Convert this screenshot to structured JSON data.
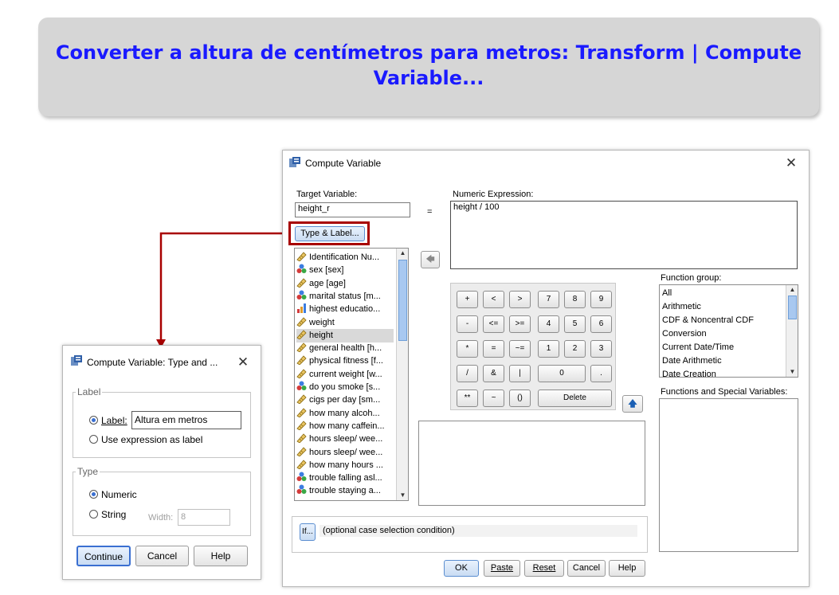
{
  "banner": {
    "title": "Converter a altura de centímetros para metros: Transform | Compute Variable..."
  },
  "compute_dialog": {
    "title": "Compute Variable",
    "target_label": "Target Variable:",
    "target_value": "height_r",
    "equals": "=",
    "expression_label": "Numeric Expression:",
    "expression_value": "height / 100",
    "type_label_button": "Type & Label...",
    "variables": [
      {
        "name": "Identification Nu...",
        "icon": "scale-icon"
      },
      {
        "name": "sex [sex]",
        "icon": "nominal-icon"
      },
      {
        "name": "age [age]",
        "icon": "scale-icon"
      },
      {
        "name": "marital status [m...",
        "icon": "nominal-icon"
      },
      {
        "name": "highest educatio...",
        "icon": "ordinal-icon"
      },
      {
        "name": "weight",
        "icon": "scale-icon"
      },
      {
        "name": "height",
        "icon": "scale-icon",
        "selected": true
      },
      {
        "name": "general health [h...",
        "icon": "scale-icon"
      },
      {
        "name": "physical fitness [f...",
        "icon": "scale-icon"
      },
      {
        "name": "current weight [w...",
        "icon": "scale-icon"
      },
      {
        "name": "do you smoke [s...",
        "icon": "nominal-icon"
      },
      {
        "name": "cigs per day  [sm...",
        "icon": "scale-icon"
      },
      {
        "name": "how  many alcoh...",
        "icon": "scale-icon"
      },
      {
        "name": "how many caffein...",
        "icon": "scale-icon"
      },
      {
        "name": "hours sleep/ wee...",
        "icon": "scale-icon"
      },
      {
        "name": "hours sleep/ wee...",
        "icon": "scale-icon"
      },
      {
        "name": "how many hours ...",
        "icon": "scale-icon"
      },
      {
        "name": "trouble falling asl...",
        "icon": "nominal-icon"
      },
      {
        "name": "trouble staying a...",
        "icon": "nominal-icon"
      }
    ],
    "keypad": {
      "row1": [
        "+",
        "<",
        ">",
        "7",
        "8",
        "9"
      ],
      "row2": [
        "-",
        "<=",
        ">=",
        "4",
        "5",
        "6"
      ],
      "row3": [
        "*",
        "=",
        "~=",
        "1",
        "2",
        "3"
      ],
      "row4": [
        "/",
        "&",
        "|",
        "0",
        "."
      ],
      "row5": [
        "**",
        "~",
        "()",
        "Delete"
      ]
    },
    "function_group_label": "Function group:",
    "function_groups": [
      "All",
      "Arithmetic",
      "CDF & Noncentral CDF",
      "Conversion",
      "Current Date/Time",
      "Date Arithmetic",
      "Date Creation"
    ],
    "functions_label": "Functions and Special Variables:",
    "if_button": "If...",
    "if_text": "(optional case selection condition)",
    "buttons": {
      "ok": "OK",
      "paste": "Paste",
      "reset": "Reset",
      "cancel": "Cancel",
      "help": "Help"
    }
  },
  "type_dialog": {
    "title": "Compute Variable: Type and ...",
    "label_group": "Label",
    "label_radio": "Label:",
    "label_value": "Altura em metros",
    "use_expression": "Use expression as label",
    "type_group": "Type",
    "numeric": "Numeric",
    "string": "String",
    "width_label": "Width:",
    "width_value": "8",
    "buttons": {
      "continue": "Continue",
      "cancel": "Cancel",
      "help": "Help"
    }
  },
  "colors": {
    "banner_bg": "#d6d6d6",
    "banner_text": "#1a1aff",
    "highlight_box": "#a80000",
    "connector": "#a80000"
  }
}
